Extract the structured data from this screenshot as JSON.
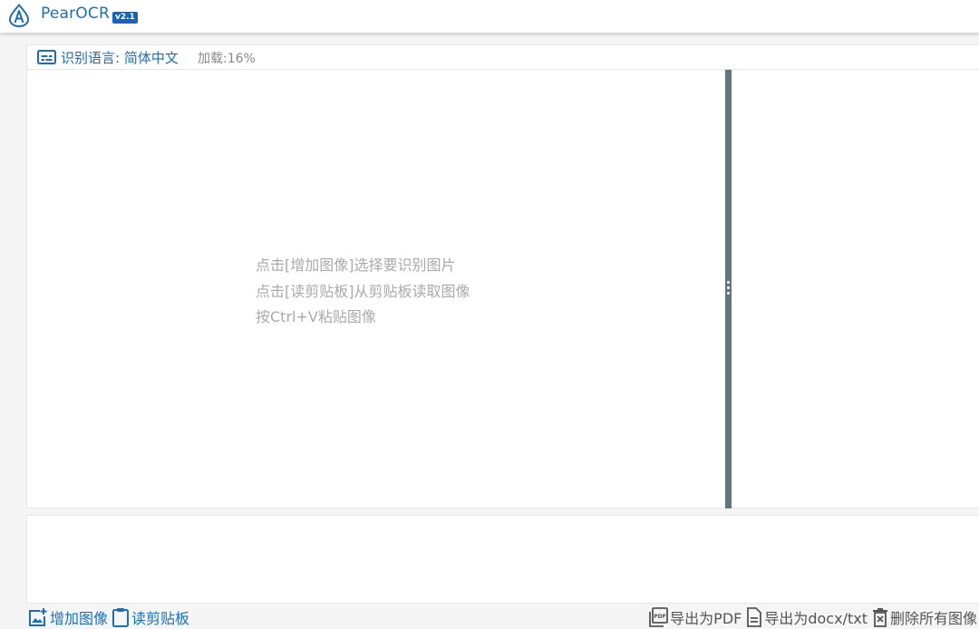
{
  "app": {
    "title": "PearOCR",
    "version": "v2.1",
    "logo_icon": "pear-a-logo-icon",
    "accent_color": "#1b6fb8"
  },
  "language_bar": {
    "icon": "subtitles-icon",
    "language_label": "识别语言: 简体中文",
    "loading_label": "加载:16%"
  },
  "main": {
    "placeholder_lines": [
      "点击[增加图像]选择要识别图片",
      "点击[读剪贴板]从剪贴板读取图像",
      "按Ctrl+V粘贴图像"
    ],
    "splitter_color": "#5f7580"
  },
  "toolbar": {
    "add_image_label": "增加图像",
    "add_image_icon": "add-image-icon",
    "read_clipboard_label": "读剪贴板",
    "read_clipboard_icon": "clipboard-icon",
    "export_pdf_label": "导出为PDF",
    "export_pdf_icon": "pdf-icon",
    "export_docx_label": "导出为docx/txt",
    "export_docx_icon": "document-icon",
    "delete_all_label": "删除所有图像",
    "delete_all_icon": "trash-icon"
  }
}
